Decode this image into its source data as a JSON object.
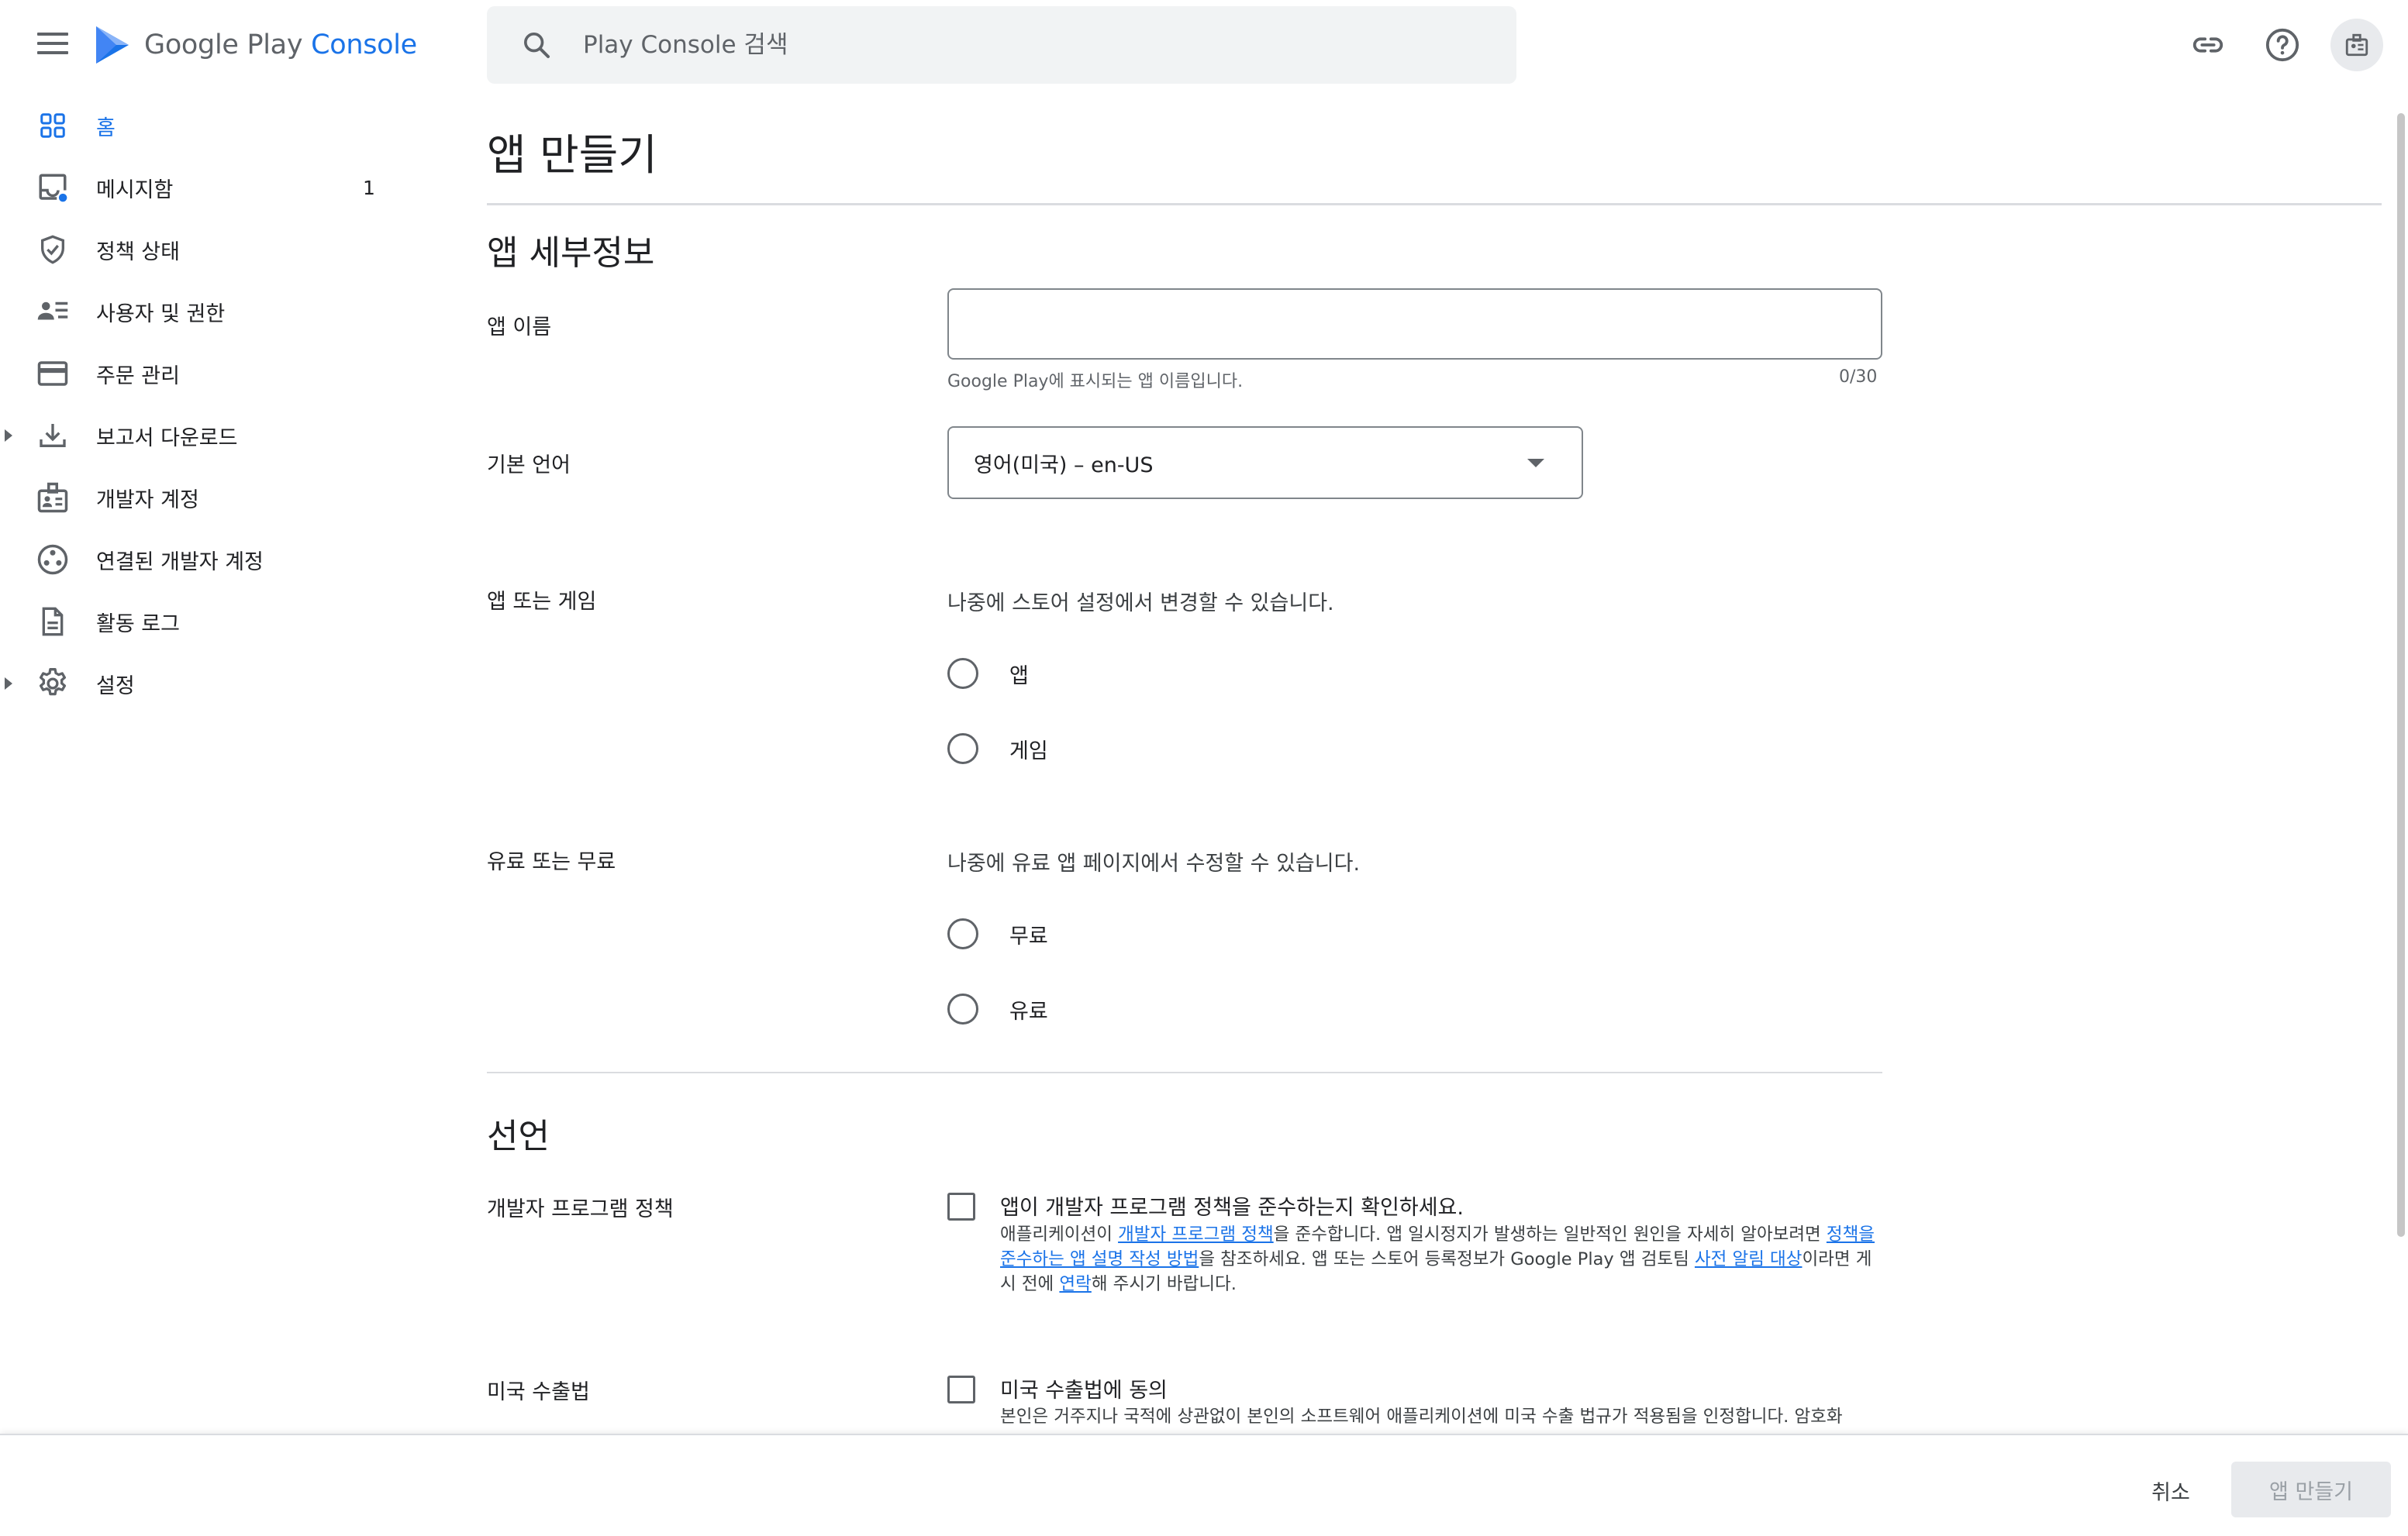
{
  "header": {
    "logo_brand": "Google Play",
    "logo_product": "Console",
    "search_placeholder": "Play Console 검색",
    "icons": [
      "menu-icon",
      "search-icon",
      "link-icon",
      "help-icon",
      "account-icon"
    ]
  },
  "sidebar": {
    "items": [
      {
        "label": "홈",
        "icon": "home-grid-icon",
        "active": true
      },
      {
        "label": "메시지함",
        "icon": "inbox-icon",
        "badge": "1"
      },
      {
        "label": "정책 상태",
        "icon": "shield-check-icon"
      },
      {
        "label": "사용자 및 권한",
        "icon": "users-icon"
      },
      {
        "label": "주문 관리",
        "icon": "credit-card-icon"
      },
      {
        "label": "보고서 다운로드",
        "icon": "download-icon",
        "expandable": true
      },
      {
        "label": "개발자 계정",
        "icon": "badge-icon"
      },
      {
        "label": "연결된 개발자 계정",
        "icon": "linked-accounts-icon"
      },
      {
        "label": "활동 로그",
        "icon": "document-icon"
      },
      {
        "label": "설정",
        "icon": "gear-icon",
        "expandable": true
      }
    ]
  },
  "main": {
    "title": "앱 만들기",
    "app_details": {
      "heading": "앱 세부정보",
      "app_name_label": "앱 이름",
      "app_name_value": "",
      "app_name_helper": "Google Play에 표시되는 앱 이름입니다.",
      "app_name_counter": "0/30",
      "language_label": "기본 언어",
      "language_value": "영어(미국) – en-US",
      "app_or_game_label": "앱 또는 게임",
      "app_or_game_hint": "나중에 스토어 설정에서 변경할 수 있습니다.",
      "app_option": "앱",
      "game_option": "게임",
      "paid_free_label": "유료 또는 무료",
      "paid_free_hint": "나중에 유료 앱 페이지에서 수정할 수 있습니다.",
      "free_option": "무료",
      "paid_option": "유료"
    },
    "declarations": {
      "heading": "선언",
      "policy_label": "개발자 프로그램 정책",
      "policy_check": "앱이 개발자 프로그램 정책을 준수하는지 확인하세요.",
      "policy_desc": {
        "t1": "애플리케이션이 ",
        "l1": "개발자 프로그램 정책",
        "t2": "을 준수합니다. 앱 일시정지가 발생하는 일반적인 원인을 자세히 알아보려면 ",
        "l2": "정책을 준수하는 앱 설명 작성 방법",
        "t3": "을 참조하세요. 앱 또는 스토어 등록정보가 Google Play 앱 검토팀 ",
        "l3": "사전 알림 대상",
        "t4": "이라면 게시 전에 ",
        "l4": "연락",
        "t5": "해 주시기 바랍니다."
      },
      "export_label": "미국 수출법",
      "export_check": "미국 수출법에 동의",
      "export_desc": "본인은 거주지나 국적에 상관없이 본인의 소프트웨어 애플리케이션에 미국 수출 법규가 적용됨을 인정합니다. 암호화"
    }
  },
  "footer": {
    "cancel_label": "취소",
    "create_label": "앱 만들기"
  },
  "colors": {
    "accent": "#1a73e8",
    "text": "#202124",
    "muted": "#5f6368",
    "border": "#dadce0"
  }
}
